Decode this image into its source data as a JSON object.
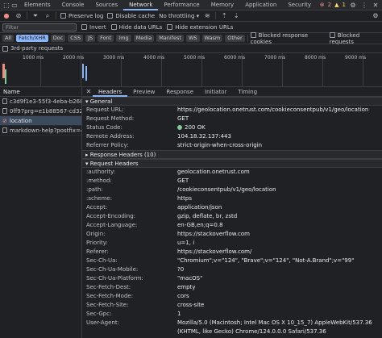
{
  "tabs": [
    "Elements",
    "Console",
    "Sources",
    "Network",
    "Performance",
    "Memory",
    "Application",
    "Security"
  ],
  "counts": {
    "errors": "2",
    "warnings": "1"
  },
  "toolbar": {
    "preserve_log": "Preserve log",
    "disable_cache": "Disable cache",
    "throttle": "No throttling"
  },
  "filter": {
    "placeholder": "Filter",
    "invert": "Invert",
    "hide_data": "Hide data URLs",
    "hide_ext": "Hide extension URLs"
  },
  "types": [
    "All",
    "Fetch/XHR",
    "Doc",
    "CSS",
    "JS",
    "Font",
    "Img",
    "Media",
    "Manifest",
    "WS",
    "Wasm",
    "Other"
  ],
  "blocked": {
    "cookies": "Blocked response cookies",
    "requests": "Blocked requests"
  },
  "third_party": "3rd-party requests",
  "timeline_ticks": [
    "1000 ms",
    "2000 ms",
    "3000 ms",
    "4000 ms",
    "5000 ms",
    "6000 ms",
    "7000 ms",
    "8000 ms",
    "9000 ms"
  ],
  "requests": {
    "header": "Name",
    "items": [
      "c3d9f1e3-55f3-4eba-b268-...",
      "0ff97prg=e1b88567-cd32-4...",
      "location",
      "markdown-help?postfix=&us..."
    ]
  },
  "detail_tabs": [
    "Headers",
    "Preview",
    "Response",
    "Initiator",
    "Timing"
  ],
  "general": {
    "title": "General",
    "rows": [
      {
        "k": "Request URL:",
        "v": "https://geolocation.onetrust.com/cookieconsentpub/v1/geo/location"
      },
      {
        "k": "Request Method:",
        "v": "GET"
      },
      {
        "k": "Status Code:",
        "v": "200 OK"
      },
      {
        "k": "Remote Address:",
        "v": "104.18.32.137:443"
      },
      {
        "k": "Referrer Policy:",
        "v": "strict-origin-when-cross-origin"
      }
    ]
  },
  "response_headers": {
    "title": "Response Headers (10)"
  },
  "request_headers": {
    "title": "Request Headers",
    "rows": [
      {
        "k": ":authority:",
        "v": "geolocation.onetrust.com"
      },
      {
        "k": ":method:",
        "v": "GET"
      },
      {
        "k": ":path:",
        "v": "/cookieconsentpub/v1/geo/location"
      },
      {
        "k": ":scheme:",
        "v": "https"
      },
      {
        "k": "Accept:",
        "v": "application/json"
      },
      {
        "k": "Accept-Encoding:",
        "v": "gzip, deflate, br, zstd"
      },
      {
        "k": "Accept-Language:",
        "v": "en-GB,en;q=0.8"
      },
      {
        "k": "Origin:",
        "v": "https://stackoverflow.com"
      },
      {
        "k": "Priority:",
        "v": "u=1, i"
      },
      {
        "k": "Referer:",
        "v": "https://stackoverflow.com/"
      },
      {
        "k": "Sec-Ch-Ua:",
        "v": "\"Chromium\";v=\"124\", \"Brave\";v=\"124\", \"Not-A.Brand\";v=\"99\""
      },
      {
        "k": "Sec-Ch-Ua-Mobile:",
        "v": "?0"
      },
      {
        "k": "Sec-Ch-Ua-Platform:",
        "v": "\"macOS\""
      },
      {
        "k": "Sec-Fetch-Dest:",
        "v": "empty"
      },
      {
        "k": "Sec-Fetch-Mode:",
        "v": "cors"
      },
      {
        "k": "Sec-Fetch-Site:",
        "v": "cross-site"
      },
      {
        "k": "Sec-Gpc:",
        "v": "1"
      },
      {
        "k": "User-Agent:",
        "v": "Mozilla/5.0 (Macintosh; Intel Mac OS X 10_15_7) AppleWebKit/537.36 (KHTML, like Gecko) Chrome/124.0.0.0 Safari/537.36"
      }
    ]
  }
}
